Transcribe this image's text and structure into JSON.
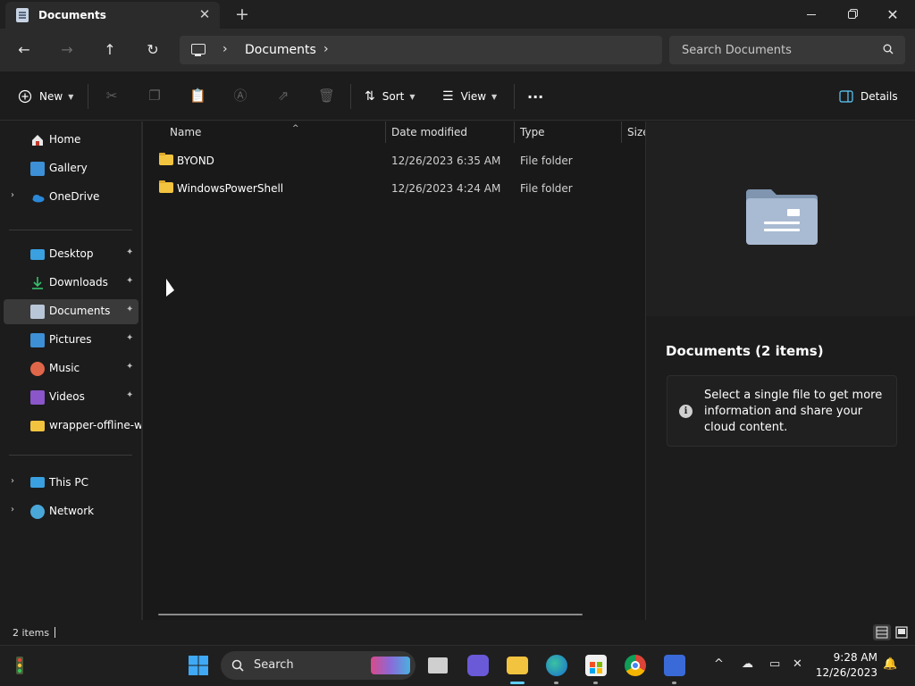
{
  "window": {
    "tab_title": "Documents",
    "tab_close": "✕",
    "new_tab": "+",
    "close_symbol": "✕"
  },
  "address_bar": {
    "crumbs": [
      "Documents"
    ],
    "separator": "›",
    "search_placeholder": "Search Documents"
  },
  "nav_buttons": {
    "back": "←",
    "forward": "→",
    "up": "↑",
    "refresh": "↻"
  },
  "command_bar": {
    "new_label": "New",
    "sort_label": "Sort",
    "view_label": "View",
    "more_label": "···",
    "details_label": "Details"
  },
  "sidebar": {
    "items": [
      {
        "label": "Home",
        "icon": "home-icon"
      },
      {
        "label": "Gallery",
        "icon": "gallery-icon"
      },
      {
        "label": "OneDrive",
        "icon": "onedrive-icon"
      },
      {
        "label": "Desktop",
        "icon": "desktop-icon"
      },
      {
        "label": "Downloads",
        "icon": "download-icon"
      },
      {
        "label": "Documents",
        "icon": "documents-icon"
      },
      {
        "label": "Pictures",
        "icon": "pictures-icon"
      },
      {
        "label": "Music",
        "icon": "music-icon"
      },
      {
        "label": "Videos",
        "icon": "videos-icon"
      },
      {
        "label": "wrapper-offline-wi",
        "icon": "folder-icon"
      },
      {
        "label": "This PC",
        "icon": "pc-icon"
      },
      {
        "label": "Network",
        "icon": "network-icon"
      }
    ],
    "expand_symbol": "›",
    "pin_symbol": "📌"
  },
  "file_list": {
    "columns": [
      "Name",
      "Date modified",
      "Type",
      "Size"
    ],
    "sort_caret": "^",
    "rows": [
      {
        "name": "BYOND",
        "date": "12/26/2023 6:35 AM",
        "type": "File folder"
      },
      {
        "name": "WindowsPowerShell",
        "date": "12/26/2023 4:24 AM",
        "type": "File folder"
      }
    ]
  },
  "details_pane": {
    "title": "Documents (2 items)",
    "info_icon": "i",
    "info_text": "Select a single file to get more information and share your cloud content."
  },
  "status_bar": {
    "count": "2 items"
  },
  "taskbar": {
    "search_label": "Search",
    "time": "9:28 AM",
    "date": "12/26/2023",
    "tray_chevron": "^"
  },
  "colors": {
    "accent": "#60cdff",
    "folder": "#f2c33f",
    "background": "#1c1c1c"
  }
}
